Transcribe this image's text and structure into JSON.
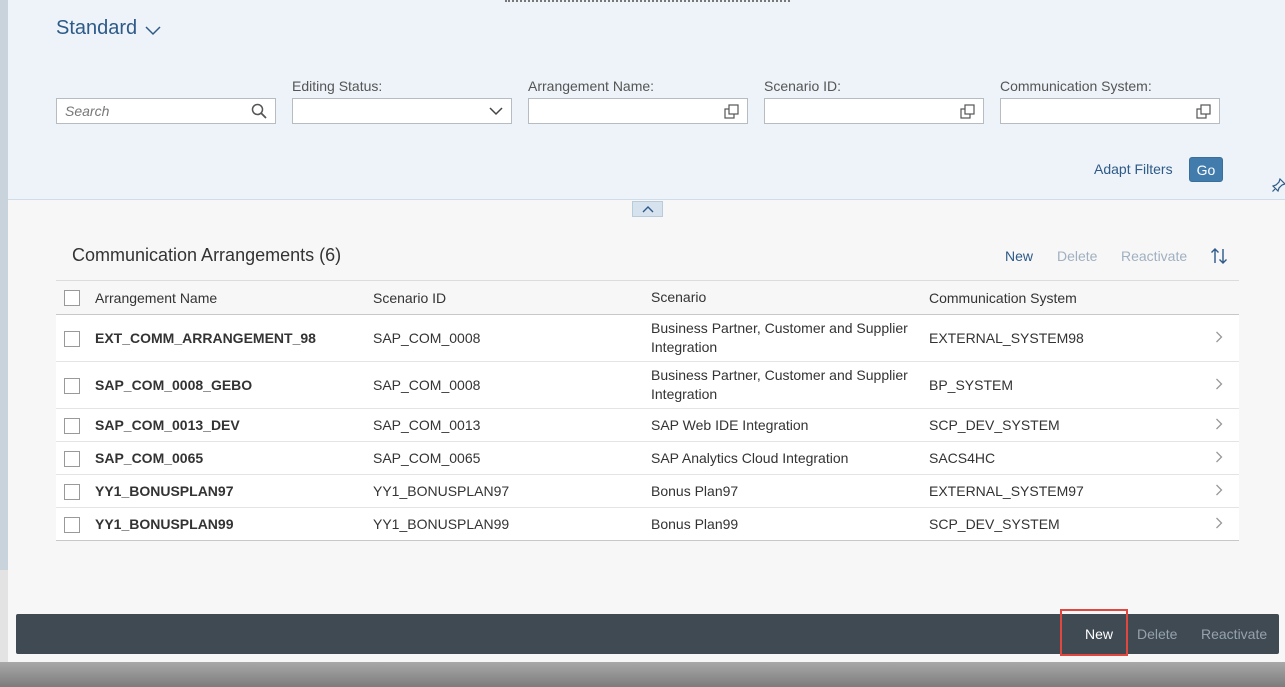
{
  "filter_bar": {
    "variant_label": "Standard",
    "search": {
      "placeholder": "Search"
    },
    "fields": [
      {
        "label": "Editing Status:",
        "value": "",
        "type": "dropdown"
      },
      {
        "label": "Arrangement Name:",
        "value": "",
        "type": "value-help"
      },
      {
        "label": "Scenario ID:",
        "value": "",
        "type": "value-help"
      },
      {
        "label": "Communication System:",
        "value": "",
        "type": "value-help"
      }
    ],
    "adapt_filters_label": "Adapt Filters",
    "go_label": "Go"
  },
  "table": {
    "title": "Communication Arrangements (6)",
    "toolbar": {
      "new": "New",
      "delete": "Delete",
      "reactivate": "Reactivate"
    },
    "columns": [
      "Arrangement Name",
      "Scenario ID",
      "Scenario",
      "Communication System"
    ],
    "rows": [
      [
        "EXT_COMM_ARRANGEMENT_98",
        "SAP_COM_0008",
        "Business Partner, Customer and Supplier Integration",
        "EXTERNAL_SYSTEM98"
      ],
      [
        "SAP_COM_0008_GEBO",
        "SAP_COM_0008",
        "Business Partner, Customer and Supplier Integration",
        "BP_SYSTEM"
      ],
      [
        "SAP_COM_0013_DEV",
        "SAP_COM_0013",
        "SAP Web IDE Integration",
        "SCP_DEV_SYSTEM"
      ],
      [
        "SAP_COM_0065",
        "SAP_COM_0065",
        "SAP Analytics Cloud Integration",
        "SACS4HC"
      ],
      [
        "YY1_BONUSPLAN97",
        "YY1_BONUSPLAN97",
        "Bonus Plan97",
        "EXTERNAL_SYSTEM97"
      ],
      [
        "YY1_BONUSPLAN99",
        "YY1_BONUSPLAN99",
        "Bonus Plan99",
        "SCP_DEV_SYSTEM"
      ]
    ]
  },
  "footer": {
    "new": "New",
    "delete": "Delete",
    "reactivate": "Reactivate"
  },
  "colors": {
    "accent": "#427cac",
    "link": "#2d5a88",
    "footer_bg": "#3f4a53",
    "highlight": "#e0473e"
  }
}
